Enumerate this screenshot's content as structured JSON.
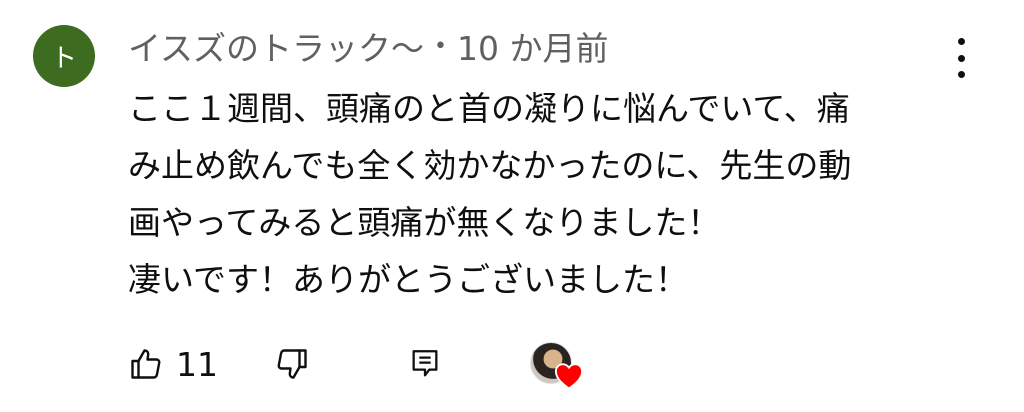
{
  "comment": {
    "avatar_letter": "ト",
    "avatar_color": "#3d6b1f",
    "author": "イスズのトラック〜",
    "separator": "•",
    "timestamp": "10 か月前",
    "lines": [
      "ここ１週間、頭痛のと首の凝りに悩んでいて、痛",
      "み止め飲んでも全く効かなかったのに、先生の動",
      "画やってみると頭痛が無くなりました！",
      "凄いです！ありがとうございました！"
    ]
  },
  "actions": {
    "like_count": "11",
    "like_icon": "thumbs-up-icon",
    "dislike_icon": "thumbs-down-icon",
    "reply_icon": "reply-icon",
    "creator_heart_icon": "heart-icon",
    "heart_color": "#ff0000"
  },
  "menu_icon": "more-vertical-icon"
}
